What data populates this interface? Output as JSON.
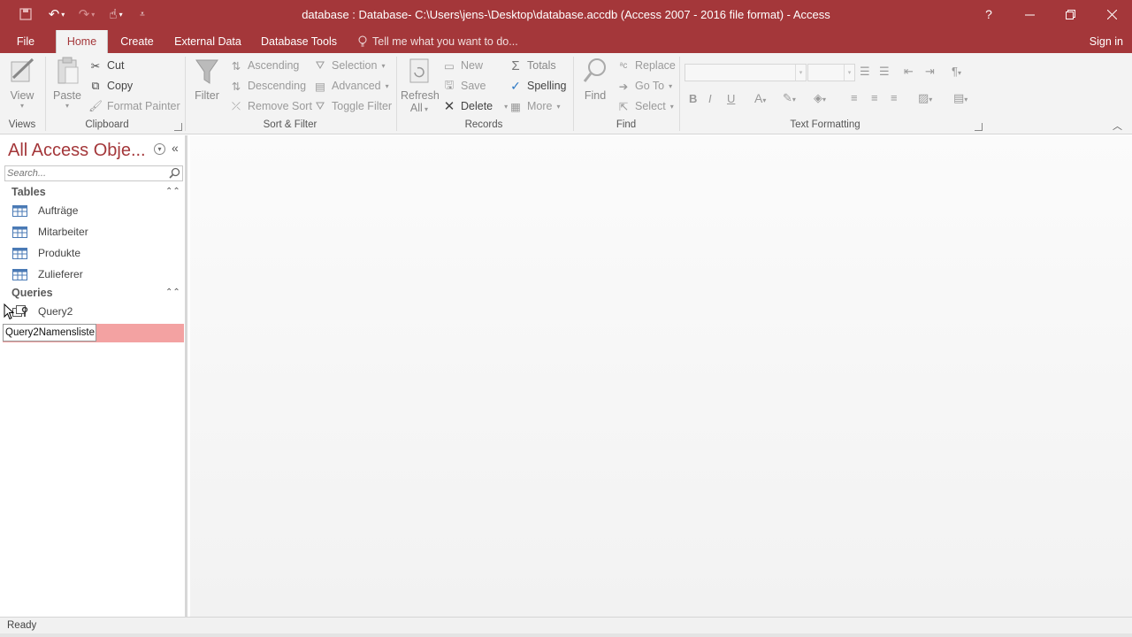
{
  "window": {
    "title": "database : Database- C:\\Users\\jens-\\Desktop\\database.accdb (Access 2007 - 2016 file format) - Access",
    "help": "?"
  },
  "tabs": [
    {
      "label": "File"
    },
    {
      "label": "Home"
    },
    {
      "label": "Create"
    },
    {
      "label": "External Data"
    },
    {
      "label": "Database Tools"
    }
  ],
  "tell_me": "Tell me what you want to do...",
  "sign_in": "Sign in",
  "ribbon": {
    "views": {
      "label": "Views",
      "view": "View"
    },
    "clipboard": {
      "label": "Clipboard",
      "paste": "Paste",
      "cut": "Cut",
      "copy": "Copy",
      "format_painter": "Format Painter"
    },
    "sort_filter": {
      "label": "Sort & Filter",
      "filter": "Filter",
      "ascending": "Ascending",
      "descending": "Descending",
      "remove_sort": "Remove Sort",
      "selection": "Selection",
      "advanced": "Advanced",
      "toggle_filter": "Toggle Filter"
    },
    "records": {
      "label": "Records",
      "refresh": "Refresh",
      "refresh_all": "All",
      "new": "New",
      "save": "Save",
      "delete": "Delete",
      "totals": "Totals",
      "spelling": "Spelling",
      "more": "More"
    },
    "find": {
      "label": "Find",
      "find": "Find",
      "replace": "Replace",
      "go_to": "Go To",
      "select": "Select"
    },
    "text_formatting": {
      "label": "Text Formatting"
    }
  },
  "nav": {
    "title": "All Access Obje...",
    "search_placeholder": "Search...",
    "tables_header": "Tables",
    "tables": [
      {
        "label": "Aufträge"
      },
      {
        "label": "Mitarbeiter"
      },
      {
        "label": "Produkte"
      },
      {
        "label": "Zulieferer"
      }
    ],
    "queries_header": "Queries",
    "queries": [
      {
        "label": "Query2"
      }
    ],
    "rename_value": "Query2Namensliste"
  },
  "status": "Ready",
  "colors": {
    "accent": "#a4373a",
    "rename_highlight": "#f3a2a2"
  }
}
